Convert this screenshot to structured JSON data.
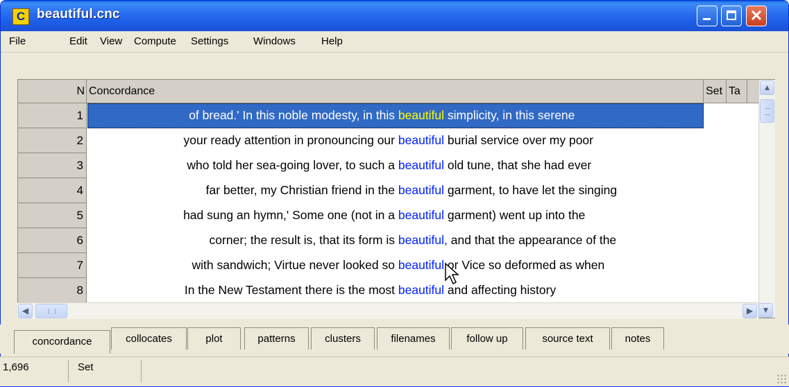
{
  "window": {
    "title": "beautiful.cnc",
    "app_icon_letter": "C"
  },
  "menu": [
    "File",
    "Edit",
    "View",
    "Compute",
    "Settings",
    "Windows",
    "Help"
  ],
  "grid": {
    "columns": {
      "n": "N",
      "concordance": "Concordance",
      "set": "Set",
      "ta": "Ta"
    },
    "rows": [
      {
        "n": "1",
        "left": "of bread.' In this noble modesty, in this",
        "keyword": "beautiful",
        "right": " simplicity, in this serene"
      },
      {
        "n": "2",
        "left": "your ready attention in pronouncing our",
        "keyword": "beautiful",
        "right": " burial service over my poor"
      },
      {
        "n": "3",
        "left": "who told her sea-going lover, to such a",
        "keyword": "beautiful",
        "right": " old tune, that she had ever"
      },
      {
        "n": "4",
        "left": "far better, my Christian friend in the",
        "keyword": "beautiful",
        "right": " garment, to have let the singing"
      },
      {
        "n": "5",
        "left": "had sung an hymn,' Some one (not in a",
        "keyword": "beautiful",
        "right": " garment) went up into the"
      },
      {
        "n": "6",
        "left": "corner; the result is, that its form is",
        "keyword": "beautiful,",
        "right": " and that the appearance of the"
      },
      {
        "n": "7",
        "left": "with sandwich; Virtue never looked so",
        "keyword": "beautiful",
        "right": " or Vice so deformed as when"
      },
      {
        "n": "8",
        "left": "In the New Testament there is the most",
        "keyword": "beautiful",
        "right": " and affecting history"
      }
    ],
    "selected_row": "1"
  },
  "tabs": [
    "concordance",
    "collocates",
    "plot",
    "patterns",
    "clusters",
    "filenames",
    "follow up",
    "source text",
    "notes"
  ],
  "active_tab": "concordance",
  "status": {
    "count": "1,696",
    "column": "Set"
  },
  "colors": {
    "titlebar": "#2a6ff0",
    "selection": "#316ac5",
    "keyword": "#0020ff",
    "keyword_selected": "#ffff00",
    "chrome": "#ece9d8"
  },
  "icons": {
    "minimize": "minimize-icon",
    "maximize": "maximize-icon",
    "close": "close-icon"
  }
}
